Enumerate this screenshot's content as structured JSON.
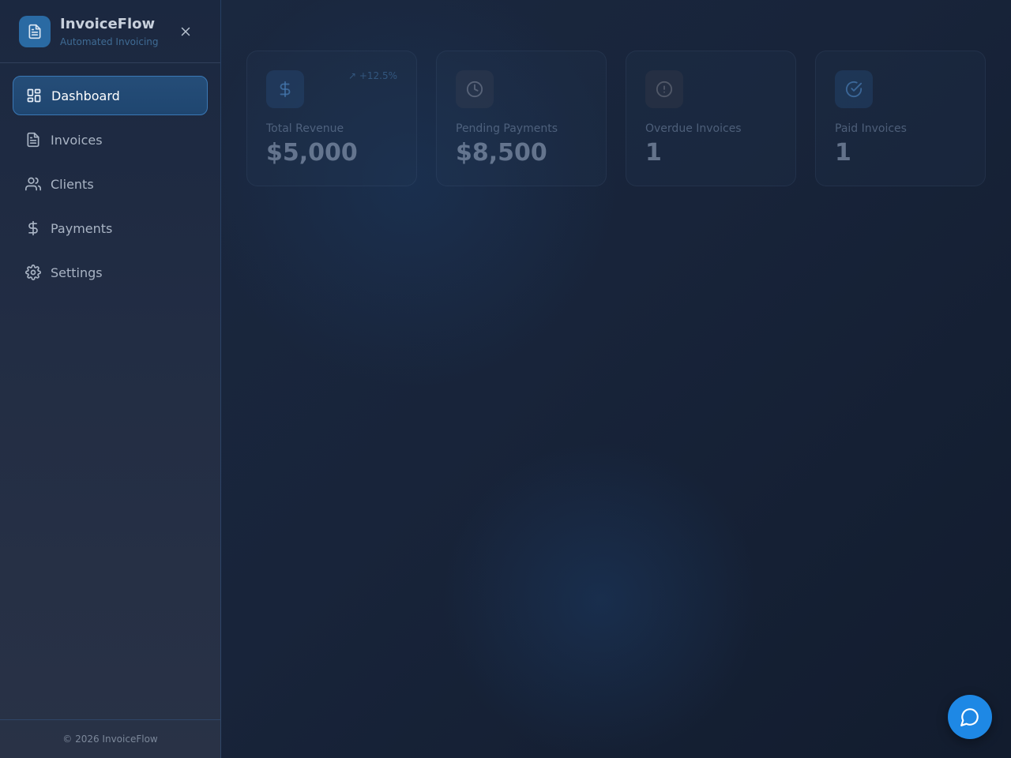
{
  "brand": {
    "title": "InvoiceFlow",
    "subtitle": "Automated Invoicing",
    "logo_icon": "document-icon"
  },
  "sidebar": {
    "close_icon": "close-icon",
    "items": [
      {
        "label": "Dashboard",
        "icon": "dashboard-grid-icon",
        "active": true
      },
      {
        "label": "Invoices",
        "icon": "document-icon",
        "active": false
      },
      {
        "label": "Clients",
        "icon": "users-icon",
        "active": false
      },
      {
        "label": "Payments",
        "icon": "dollar-icon",
        "active": false
      },
      {
        "label": "Settings",
        "icon": "gear-icon",
        "active": false
      }
    ],
    "footer": "© 2026 InvoiceFlow"
  },
  "stats": [
    {
      "label": "Total Revenue",
      "value": "$5,000",
      "trend": "↗ +12.5%",
      "icon": "dollar-icon"
    },
    {
      "label": "Pending Payments",
      "value": "$8,500",
      "icon": "clock-icon"
    },
    {
      "label": "Overdue Invoices",
      "value": "1",
      "icon": "alert-circle-icon"
    },
    {
      "label": "Paid Invoices",
      "value": "1",
      "icon": "check-circle-icon"
    }
  ],
  "colors": {
    "accent": "#1e88e5",
    "active_nav": "#254d78",
    "logo_bg": "#2a6aa3"
  },
  "chat": {
    "icon": "chat-bubble-icon"
  }
}
